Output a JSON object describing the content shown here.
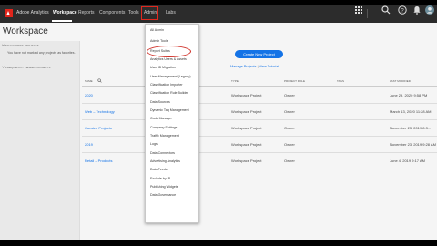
{
  "app": {
    "brand": "Adobe Analytics",
    "nav": [
      "Workspace",
      "Reports",
      "Components",
      "Tools",
      "Admin",
      "Labs"
    ],
    "active_nav": "Workspace"
  },
  "page": {
    "title": "Workspace"
  },
  "sidebar": {
    "favorites_header": "My Favorite Projects",
    "favorites_empty": "You have not marked any projects as favorites.",
    "frequent_header": "Frequently Viewed Projects"
  },
  "actions": {
    "create_label": "Create New Project",
    "manage_label": "Manage Projects",
    "separator": "|",
    "tutorial_label": "View Tutorial"
  },
  "table": {
    "columns": [
      "Name",
      "Type",
      "Project Role",
      "Tags",
      "Last Modified"
    ],
    "rows": [
      {
        "name": "2020",
        "type": "Workspace Project",
        "role": "Owner",
        "modified": "June 29, 2020 9:58 PM"
      },
      {
        "name": "Web – Technology",
        "type": "Workspace Project",
        "role": "Owner",
        "modified": "March 13, 2020 11:28 AM"
      },
      {
        "name": "Curated Projects",
        "type": "Workspace Project",
        "role": "Owner",
        "modified": "November 23, 2019 8:3..."
      },
      {
        "name": "2019",
        "type": "Workspace Project",
        "role": "Owner",
        "modified": "November 23, 2019 9:28 AM"
      },
      {
        "name": "Retail – Products",
        "type": "Workspace Project",
        "role": "Owner",
        "modified": "June 4, 2019 9:17 AM"
      }
    ]
  },
  "admin_menu": {
    "items": [
      "All Admin",
      "Admin Tools",
      "Report Suites",
      "Analytics Users & Assets",
      "User ID Migration",
      "User Management (Legacy)",
      "Classification Importer",
      "Classification Rule Builder",
      "Data Sources",
      "Dynamic Tag Management",
      "Code Manager",
      "Company Settings",
      "Traffic Management",
      "Logs",
      "Data Connectors",
      "Advertising Analytics",
      "Data Feeds",
      "Exclude by IP",
      "Publishing Widgets",
      "Data Governance"
    ],
    "highlighted": "Report Suites"
  },
  "colors": {
    "accent_blue": "#1473e6",
    "highlight_red": "#d0322a",
    "nav_bg": "#2c2c2c"
  }
}
